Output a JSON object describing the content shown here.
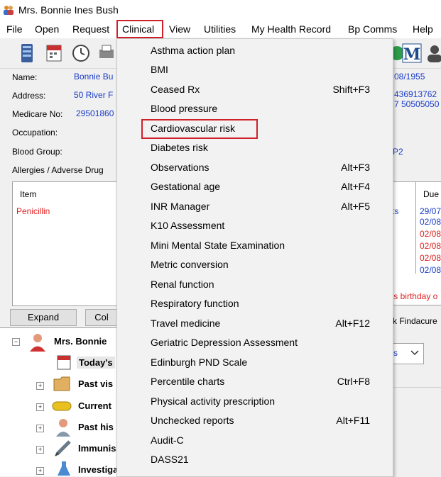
{
  "window": {
    "title": "Mrs. Bonnie Ines Bush"
  },
  "menubar": {
    "items": [
      "File",
      "Open",
      "Request",
      "Clinical",
      "View",
      "Utilities",
      "My Health Record",
      "Bp Comms",
      "Help"
    ],
    "active": "Clinical"
  },
  "patient": {
    "name_label": "Name:",
    "name_value": "Bonnie Bu",
    "address_label": "Address:",
    "address_value": "50 River F",
    "medicare_label": "Medicare No:",
    "medicare_value": "29501860",
    "occupation_label": "Occupation:",
    "blood_group_label": "Blood Group:",
    "allergies_label": "Allergies / Adverse Drug",
    "dob_value": "08/1955",
    "phone1": "436913762",
    "phone2": "7 50505050",
    "p2": "P2"
  },
  "allergies": {
    "header": "Item",
    "items": [
      "Penicillin"
    ]
  },
  "recalls": {
    "header": "Due",
    "left_fragment": "ts",
    "dates": [
      "29/07",
      "02/08",
      "02/08",
      "02/08",
      "02/08",
      "02/08"
    ],
    "date_colors": [
      "blue",
      "blue",
      "red",
      "red",
      "red",
      "blue"
    ],
    "birthday_note": "'s birthday o"
  },
  "buttons": {
    "expand": "Expand",
    "collapse": "Col"
  },
  "findacure": "k Findacure",
  "tree": {
    "root": "Mrs. Bonnie",
    "items": [
      "Today's",
      "Past vis",
      "Current",
      "Past his",
      "Immunis",
      "Investigation reports"
    ]
  },
  "icons": [
    "user-icon",
    "server-icon",
    "calendar-icon",
    "clock-icon",
    "printer-icon",
    "circle-icon",
    "m-logo-icon"
  ],
  "clinical_menu": {
    "items": [
      {
        "label": "Asthma action plan",
        "shortcut": ""
      },
      {
        "label": "BMI",
        "shortcut": ""
      },
      {
        "label": "Ceased Rx",
        "shortcut": "Shift+F3"
      },
      {
        "label": "Blood pressure",
        "shortcut": ""
      },
      {
        "label": "Cardiovascular risk",
        "shortcut": ""
      },
      {
        "label": "Diabetes risk",
        "shortcut": ""
      },
      {
        "label": "Observations",
        "shortcut": "Alt+F3"
      },
      {
        "label": "Gestational age",
        "shortcut": "Alt+F4"
      },
      {
        "label": "INR Manager",
        "shortcut": "Alt+F5"
      },
      {
        "label": "K10 Assessment",
        "shortcut": ""
      },
      {
        "label": "Mini Mental State Examination",
        "shortcut": ""
      },
      {
        "label": "Metric conversion",
        "shortcut": ""
      },
      {
        "label": "Renal function",
        "shortcut": ""
      },
      {
        "label": "Respiratory function",
        "shortcut": ""
      },
      {
        "label": "Travel medicine",
        "shortcut": "Alt+F12"
      },
      {
        "label": "Geriatric Depression Assessment",
        "shortcut": ""
      },
      {
        "label": "Edinburgh PND Scale",
        "shortcut": ""
      },
      {
        "label": "Percentile charts",
        "shortcut": "Ctrl+F8"
      },
      {
        "label": "Physical activity prescription",
        "shortcut": ""
      },
      {
        "label": "Unchecked reports",
        "shortcut": "Alt+F11"
      },
      {
        "label": "Audit-C",
        "shortcut": ""
      },
      {
        "label": "DASS21",
        "shortcut": ""
      }
    ],
    "highlighted": "Cardiovascular risk"
  },
  "colors": {
    "highlight_border": "#d0202a",
    "link_blue": "#1a3cc8",
    "alert_red": "#e02020"
  }
}
